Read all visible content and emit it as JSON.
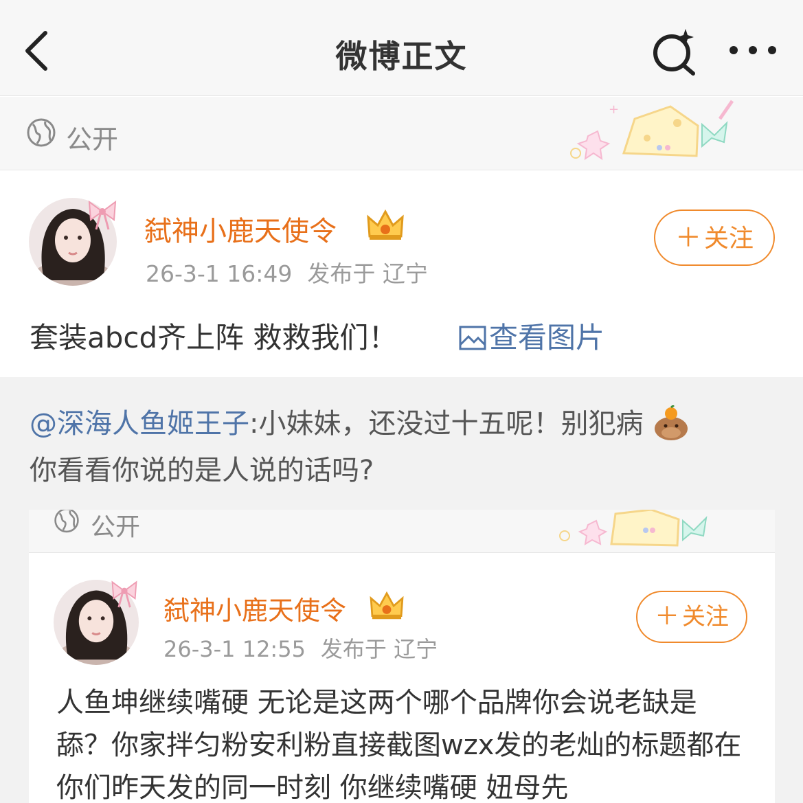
{
  "header": {
    "title": "微博正文",
    "back_icon": "chevron-left-icon",
    "search_icon": "sparkle-search-icon",
    "more_icon": "more-dots-icon"
  },
  "visibility": {
    "icon": "globe-icon",
    "label": "公开"
  },
  "post": {
    "username": "弑神小鹿天使令",
    "badge": "crown-icon",
    "time": "26-3-1 16:49",
    "location": "发布于 辽宁",
    "follow_label": "关注",
    "text": "套装abcd齐上阵 救救我们！",
    "view_pictures": "查看图片"
  },
  "repost": {
    "mention": "@深海人鱼姬王子",
    "text_line1": ":小妹妹，还没过十五呢！别犯病",
    "text_line2": "你看看你说的是人说的话吗?",
    "emoji": "capybara-icon"
  },
  "embedded": {
    "visibility_label": "公开",
    "username": "弑神小鹿天使令",
    "time": "26-3-1 12:55",
    "location": "发布于 辽宁",
    "follow_label": "关注",
    "text": "人鱼坤继续嘴硬 无论是这两个哪个品牌你会说老缺是舔？你家拌匀粉安利粉直接截图wzx发的老灿的标题都在你们昨天发的同一时刻 你继续嘴硬 妞母先"
  },
  "colors": {
    "accent_orange": "#f08a2c",
    "username_orange": "#e8701a",
    "link_blue": "#4f74a8",
    "header_bg": "#f7f7f7",
    "repost_bg": "#f2f2f2"
  }
}
